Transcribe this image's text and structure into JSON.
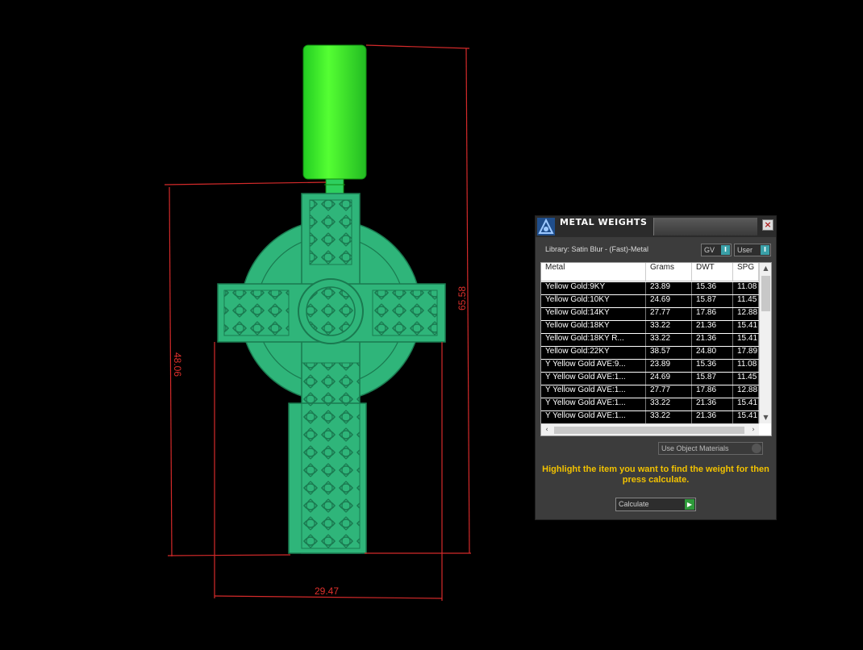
{
  "dimensions": {
    "width": "29.47",
    "height_cross": "48.06",
    "height_total": "65.58"
  },
  "panel": {
    "title": "METAL WEIGHTS",
    "close_label": "×",
    "library": "Library: Satin Blur - (Fast)-Metal",
    "toggle_gv": "GV",
    "toggle_user": "User",
    "columns": [
      "Metal",
      "Grams",
      "DWT",
      "SPG"
    ],
    "rows": [
      [
        "Yellow Gold:9KY",
        "23.89",
        "15.36",
        "11.08"
      ],
      [
        "Yellow Gold:10KY",
        "24.69",
        "15.87",
        "11.45"
      ],
      [
        "Yellow Gold:14KY",
        "27.77",
        "17.86",
        "12.88"
      ],
      [
        "Yellow Gold:18KY",
        "33.22",
        "21.36",
        "15.41"
      ],
      [
        "Yellow Gold:18KY R...",
        "33.22",
        "21.36",
        "15.41"
      ],
      [
        "Yellow Gold:22KY",
        "38.57",
        "24.80",
        "17.89"
      ],
      [
        "Y Yellow Gold AVE:9...",
        "23.89",
        "15.36",
        "11.08"
      ],
      [
        "Y Yellow Gold AVE:1...",
        "24.69",
        "15.87",
        "11.45"
      ],
      [
        "Y Yellow Gold AVE:1...",
        "27.77",
        "17.86",
        "12.88"
      ],
      [
        "Y Yellow Gold AVE:1...",
        "33.22",
        "21.36",
        "15.41"
      ],
      [
        "Y Yellow Gold AVE:1...",
        "33.22",
        "21.36",
        "15.41"
      ]
    ],
    "use_object_materials": "Use Object Materials",
    "instruction": "Highlight the item you want to find the weight for then press calculate.",
    "calculate": "Calculate"
  },
  "colors": {
    "pendant": "#2fb57a",
    "bail": "#33ee22",
    "dimension_line": "#d42a2a",
    "instruction": "#f2c200"
  }
}
